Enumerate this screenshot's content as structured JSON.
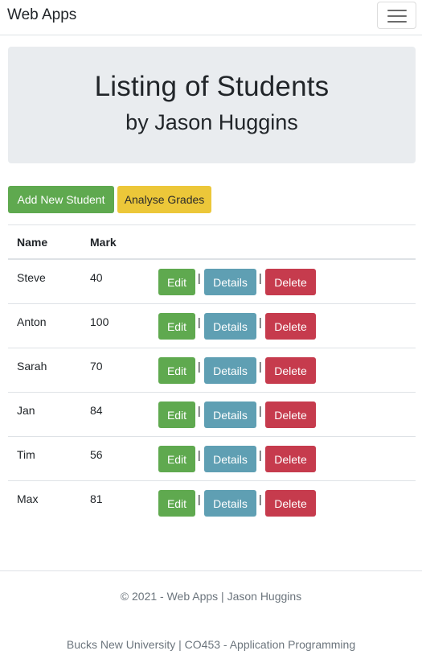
{
  "navbar": {
    "brand": "Web Apps",
    "menu_icon": "hamburger-icon"
  },
  "jumbotron": {
    "title": "Listing of Students",
    "subtitle": "by Jason Huggins"
  },
  "actions": {
    "add_label": "Add New Student",
    "analyse_label": "Analyse Grades"
  },
  "table": {
    "headers": {
      "name": "Name",
      "mark": "Mark"
    },
    "separator": "|",
    "rows": [
      {
        "name": "Steve",
        "mark": "40",
        "edit": "Edit",
        "details": "Details",
        "delete": "Delete"
      },
      {
        "name": "Anton",
        "mark": "100",
        "edit": "Edit",
        "details": "Details",
        "delete": "Delete"
      },
      {
        "name": "Sarah",
        "mark": "70",
        "edit": "Edit",
        "details": "Details",
        "delete": "Delete"
      },
      {
        "name": "Jan",
        "mark": "84",
        "edit": "Edit",
        "details": "Details",
        "delete": "Delete"
      },
      {
        "name": "Tim",
        "mark": "56",
        "edit": "Edit",
        "details": "Details",
        "delete": "Delete"
      },
      {
        "name": "Max",
        "mark": "81",
        "edit": "Edit",
        "details": "Details",
        "delete": "Delete"
      }
    ]
  },
  "footer": {
    "copyright": "© 2021 - Web Apps | Jason Huggins",
    "university": "Bucks New University | CO453 - Application Programming"
  },
  "colors": {
    "success": "#5fa94f",
    "warning": "#ecc739",
    "info": "#5f9fb3",
    "danger": "#c63b4d",
    "jumbotron_bg": "#e9ecef",
    "muted_text": "#6c757d"
  }
}
